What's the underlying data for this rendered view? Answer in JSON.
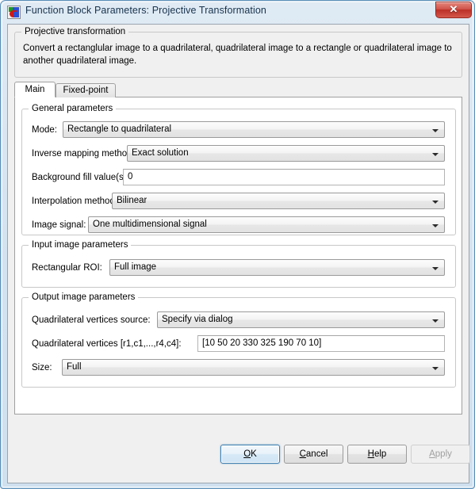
{
  "window": {
    "title": "Function Block Parameters: Projective Transformation",
    "icon": "simulink-block-icon",
    "close_label": "✕"
  },
  "description": {
    "group_title": "Projective transformation",
    "text": "Convert a rectanglular image to a quadrilateral, quadrilateral image to a rectangle or quadrilateral image to another quadrilateral image."
  },
  "tabs": [
    {
      "label": "Main",
      "active": true
    },
    {
      "label": "Fixed-point",
      "active": false
    }
  ],
  "general": {
    "group_title": "General parameters",
    "mode": {
      "label": "Mode:",
      "value": "Rectangle to quadrilateral",
      "type": "combo"
    },
    "inverse_mapping": {
      "label": "Inverse mapping method:",
      "value": "Exact solution",
      "type": "combo"
    },
    "background_fill": {
      "label": "Background fill value(s):",
      "value": "0",
      "type": "text"
    },
    "interpolation": {
      "label": "Interpolation method:",
      "value": "Bilinear",
      "type": "combo"
    },
    "image_signal": {
      "label": "Image signal:",
      "value": "One multidimensional signal",
      "type": "combo"
    }
  },
  "input_image": {
    "group_title": "Input image parameters",
    "rectangular_roi": {
      "label": "Rectangular ROI:",
      "value": "Full image",
      "type": "combo"
    }
  },
  "output_image": {
    "group_title": "Output image parameters",
    "vertices_source": {
      "label": "Quadrilateral vertices source:",
      "value": "Specify via dialog",
      "type": "combo"
    },
    "vertices": {
      "label": "Quadrilateral vertices [r1,c1,...,r4,c4]:",
      "value": "[10 50 20 330 325 190 70 10]",
      "type": "text"
    },
    "size": {
      "label": "Size:",
      "value": "Full",
      "type": "combo"
    }
  },
  "buttons": {
    "ok": {
      "label": "OK",
      "mnemonic": "O",
      "default": true,
      "enabled": true
    },
    "cancel": {
      "label": "Cancel",
      "mnemonic": "C",
      "default": false,
      "enabled": true
    },
    "help": {
      "label": "Help",
      "mnemonic": "H",
      "default": false,
      "enabled": true
    },
    "apply": {
      "label": "Apply",
      "mnemonic": "A",
      "default": false,
      "enabled": false
    }
  },
  "colors": {
    "window_border": "#5a8fb8",
    "titlebar_text": "#17334d",
    "close_button": "#bb3027",
    "client_bg": "#f0f0f0",
    "panel_bg": "#ffffff",
    "default_button_border": "#3c7fb1"
  }
}
